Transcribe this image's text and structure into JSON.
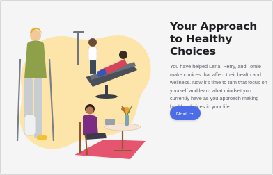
{
  "lesson": {
    "title": "Your Approach to Healthy Choices",
    "body": "You have helped Lena, Perry, and Tomie make choices that affect their health and wellness. Now it's time to turn that focus on yourself and learn what mindset you currently have as you approach making healthy choices in your life.",
    "next_label": "Next",
    "next_icon": "→"
  },
  "colors": {
    "accent": "#4d6ce8",
    "blob": "#fde4a8",
    "page_bg": "#f5f5f5"
  },
  "icons": {
    "next": "arrow-right-icon"
  }
}
